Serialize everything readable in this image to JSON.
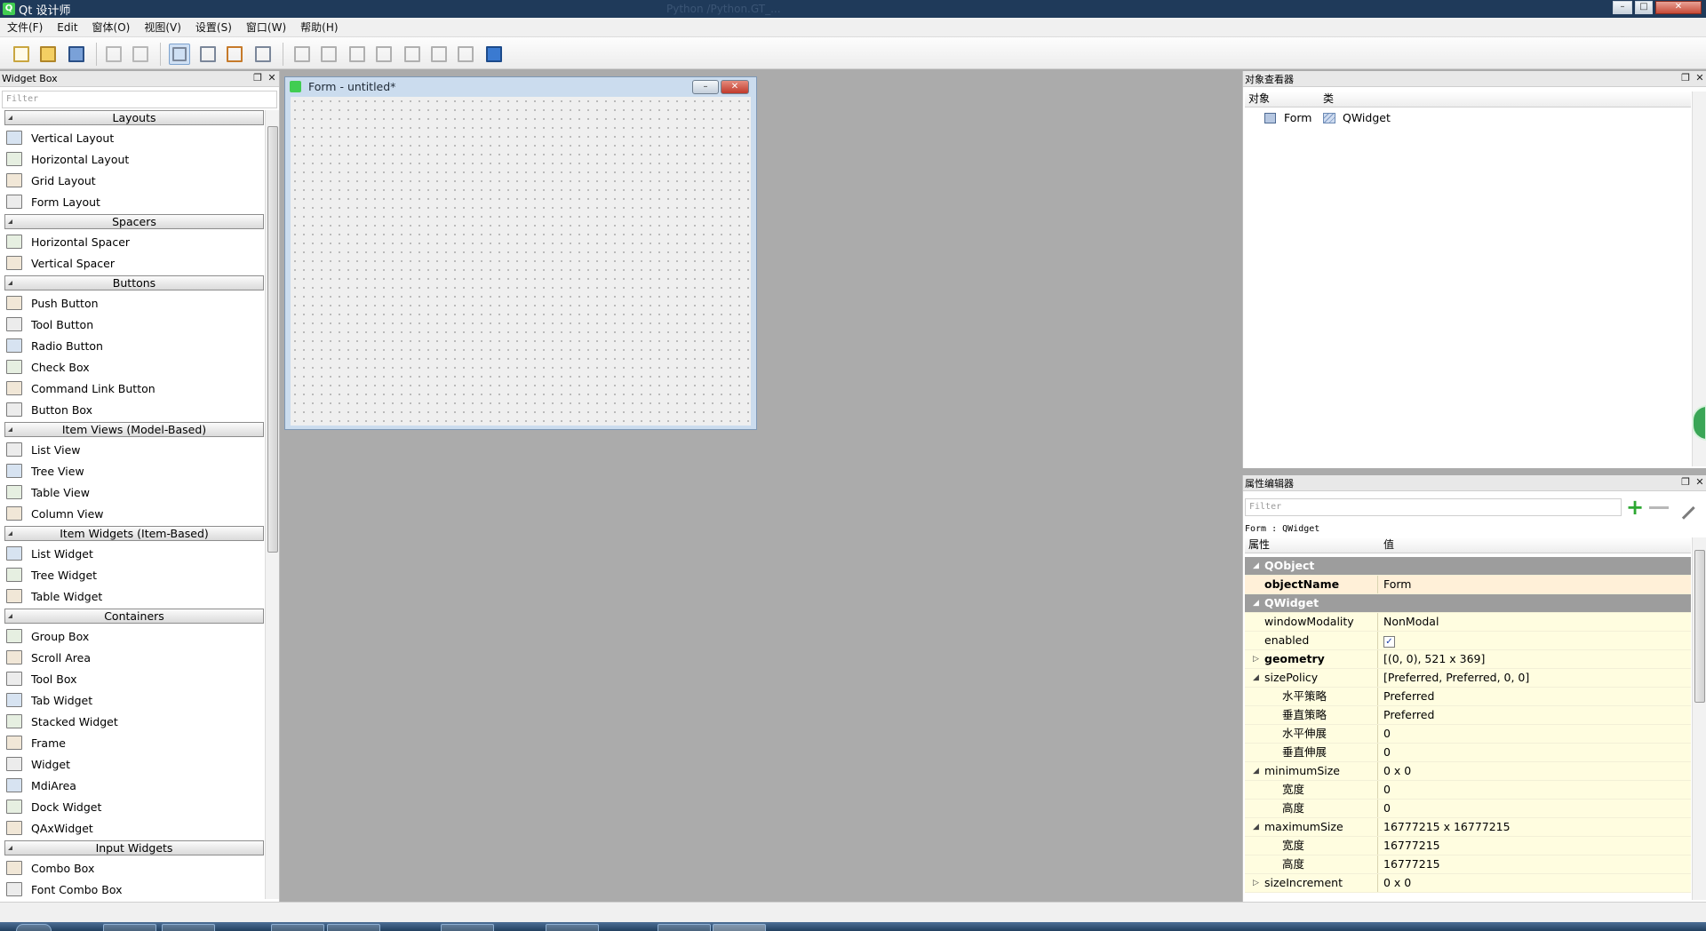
{
  "window": {
    "title": "Qt 设计师",
    "subtitle": "Python /Python.GT_...",
    "controls": {
      "minimize": "–",
      "maximize": "□",
      "close": "✕"
    }
  },
  "menu": [
    "文件(F)",
    "Edit",
    "窗体(O)",
    "视图(V)",
    "设置(S)",
    "窗口(W)",
    "帮助(H)"
  ],
  "widget_box": {
    "title": "Widget Box",
    "filter_placeholder": "Filter",
    "categories": [
      {
        "name": "Layouts",
        "items": [
          "Vertical Layout",
          "Horizontal Layout",
          "Grid Layout",
          "Form Layout"
        ]
      },
      {
        "name": "Spacers",
        "items": [
          "Horizontal Spacer",
          "Vertical Spacer"
        ]
      },
      {
        "name": "Buttons",
        "items": [
          "Push Button",
          "Tool Button",
          "Radio Button",
          "Check Box",
          "Command Link Button",
          "Button Box"
        ]
      },
      {
        "name": "Item Views (Model-Based)",
        "items": [
          "List View",
          "Tree View",
          "Table View",
          "Column View"
        ]
      },
      {
        "name": "Item Widgets (Item-Based)",
        "items": [
          "List Widget",
          "Tree Widget",
          "Table Widget"
        ]
      },
      {
        "name": "Containers",
        "items": [
          "Group Box",
          "Scroll Area",
          "Tool Box",
          "Tab Widget",
          "Stacked Widget",
          "Frame",
          "Widget",
          "MdiArea",
          "Dock Widget",
          "QAxWidget"
        ]
      },
      {
        "name": "Input Widgets",
        "items": [
          "Combo Box",
          "Font Combo Box"
        ]
      }
    ]
  },
  "form": {
    "title": "Form - untitled*"
  },
  "object_inspector": {
    "title": "对象查看器",
    "col_object": "对象",
    "col_class": "类",
    "rows": [
      {
        "object": "Form",
        "class": "QWidget"
      }
    ]
  },
  "property_editor": {
    "title": "属性编辑器",
    "filter_placeholder": "Filter",
    "context": "Form : QWidget",
    "col_property": "属性",
    "col_value": "值",
    "rows": [
      {
        "name": "QObject",
        "value": "",
        "kind": "group",
        "expand": "◢"
      },
      {
        "name": "objectName",
        "value": "Form",
        "kind": "or",
        "bold": true
      },
      {
        "name": "QWidget",
        "value": "",
        "kind": "group",
        "expand": "◢"
      },
      {
        "name": "windowModality",
        "value": "NonModal",
        "kind": "yl"
      },
      {
        "name": "enabled",
        "value": "✓",
        "kind": "yl",
        "checkbox": true
      },
      {
        "name": "geometry",
        "value": "[(0, 0), 521 x 369]",
        "kind": "yl",
        "bold": true,
        "expand": "▷"
      },
      {
        "name": "sizePolicy",
        "value": "[Preferred, Preferred, 0, 0]",
        "kind": "yl",
        "expand": "◢"
      },
      {
        "name": "水平策略",
        "value": "Preferred",
        "kind": "yl",
        "sub": true
      },
      {
        "name": "垂直策略",
        "value": "Preferred",
        "kind": "yl",
        "sub": true
      },
      {
        "name": "水平伸展",
        "value": "0",
        "kind": "yl",
        "sub": true
      },
      {
        "name": "垂直伸展",
        "value": "0",
        "kind": "yl",
        "sub": true
      },
      {
        "name": "minimumSize",
        "value": "0 x 0",
        "kind": "yl",
        "expand": "◢"
      },
      {
        "name": "宽度",
        "value": "0",
        "kind": "yl",
        "sub": true
      },
      {
        "name": "高度",
        "value": "0",
        "kind": "yl",
        "sub": true
      },
      {
        "name": "maximumSize",
        "value": "16777215 x 16777215",
        "kind": "yl",
        "expand": "◢"
      },
      {
        "name": "宽度",
        "value": "16777215",
        "kind": "yl",
        "sub": true
      },
      {
        "name": "高度",
        "value": "16777215",
        "kind": "yl",
        "sub": true
      },
      {
        "name": "sizeIncrement",
        "value": "0 x 0",
        "kind": "yl",
        "expand": "▷"
      }
    ]
  },
  "colors": {
    "accent": "#41cd52",
    "title_bar": "#1f3a5a",
    "group_row": "#9d9d9d",
    "value_row": "#fffde0"
  }
}
